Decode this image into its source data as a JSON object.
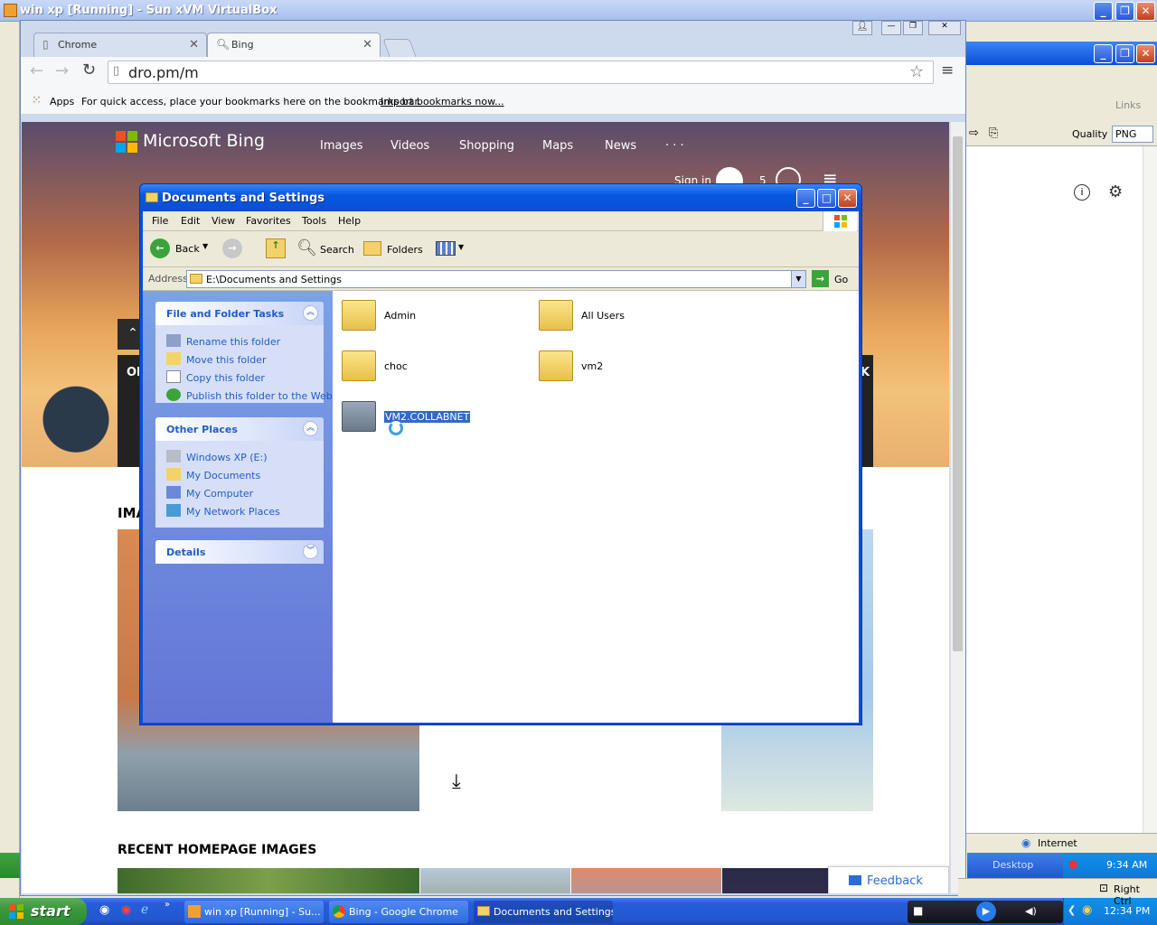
{
  "host": {
    "title": "win xp [Running] - Sun xVM VirtualBox",
    "links_label": "Links",
    "quality_label": "Quality",
    "quality_value": "PNG",
    "status_zone": "Internet",
    "tray_desktop": "Desktop",
    "tray_time_top": "9:34 AM",
    "tray_right_ctrl": "Right Ctrl",
    "tray_time": "12:34 PM"
  },
  "chrome": {
    "tabs": [
      {
        "label": "Chrome"
      },
      {
        "label": "Bing"
      }
    ],
    "url": "dro.pm/m",
    "bookmarks": {
      "apps_label": "Apps",
      "hint": "For quick access, place your bookmarks here on the bookmarks bar.",
      "import_link": "Import bookmarks now..."
    }
  },
  "bing": {
    "brand": "Microsoft Bing",
    "nav": [
      "Images",
      "Videos",
      "Shopping",
      "Maps",
      "News",
      "· · ·"
    ],
    "sign_in": "Sign in",
    "rewards_count": "5",
    "images_heading": "IMA",
    "recent_heading": "RECENT HOMEPAGE IMAGES",
    "feedback": "Feedback",
    "left_peek": "Ob",
    "right_peek": "K"
  },
  "explorer": {
    "title": "Documents and Settings",
    "menu": [
      "File",
      "Edit",
      "View",
      "Favorites",
      "Tools",
      "Help"
    ],
    "toolbar": {
      "back": "Back",
      "search": "Search",
      "folders": "Folders"
    },
    "address_label": "Address",
    "address_value": "E:\\Documents and Settings",
    "go_label": "Go",
    "file_tasks": {
      "heading": "File and Folder Tasks",
      "items": [
        "Rename this folder",
        "Move this folder",
        "Copy this folder",
        "Publish this folder to the Web"
      ]
    },
    "other_places": {
      "heading": "Other Places",
      "items": [
        "Windows XP (E:)",
        "My Documents",
        "My Computer",
        "My Network Places"
      ]
    },
    "details": {
      "heading": "Details"
    },
    "folders": [
      {
        "name": "Admin"
      },
      {
        "name": "All Users"
      },
      {
        "name": "choc"
      },
      {
        "name": "vm2"
      },
      {
        "name": "VM2.COLLABNET",
        "selected": true
      }
    ]
  },
  "taskbar": {
    "start": "start",
    "items": [
      "win xp [Running] - Su...",
      "Bing - Google Chrome",
      "Documents and Settings"
    ]
  }
}
